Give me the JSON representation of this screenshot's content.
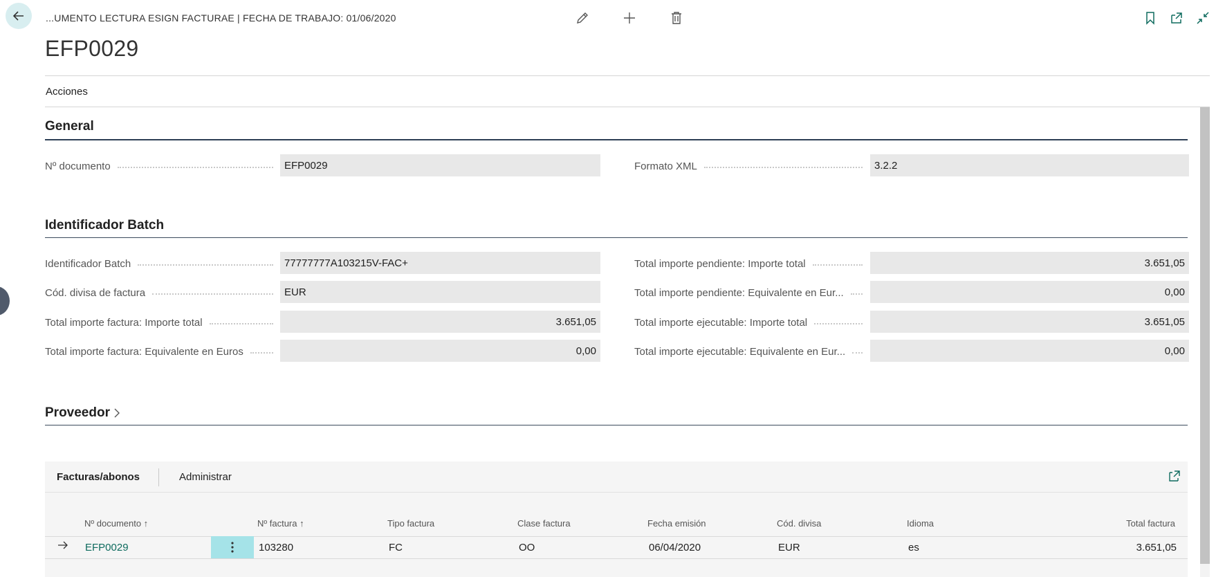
{
  "header": {
    "breadcrumb": "...UMENTO LECTURA ESIGN FACTURAE | FECHA DE TRABAJO: 01/06/2020",
    "title": "EFP0029",
    "actions_menu": "Acciones"
  },
  "icons": {
    "back": "back-arrow-icon",
    "edit": "pencil-icon",
    "new": "plus-icon",
    "delete": "trash-icon",
    "bookmark": "bookmark-icon",
    "open_new": "open-new-window-icon",
    "collapse": "collapse-icon"
  },
  "sections": {
    "general": {
      "title": "General",
      "fields": {
        "doc_no": {
          "label": "Nº documento",
          "value": "EFP0029"
        },
        "xml_format": {
          "label": "Formato XML",
          "value": "3.2.2"
        }
      }
    },
    "batch": {
      "title": "Identificador Batch",
      "fields": {
        "batch_id": {
          "label": "Identificador Batch",
          "value": "77777777A103215V-FAC+"
        },
        "currency": {
          "label": "Cód. divisa de factura",
          "value": "EUR"
        },
        "inv_total": {
          "label": "Total importe factura: Importe total",
          "value": "3.651,05"
        },
        "inv_total_eur": {
          "label": "Total importe factura: Equivalente en Euros",
          "value": "0,00"
        },
        "pend_total": {
          "label": "Total importe pendiente: Importe total",
          "value": "3.651,05"
        },
        "pend_total_eur": {
          "label": "Total importe pendiente: Equivalente en Eur...",
          "value": "0,00"
        },
        "exec_total": {
          "label": "Total importe ejecutable: Importe total",
          "value": "3.651,05"
        },
        "exec_total_eur": {
          "label": "Total importe ejecutable: Equivalente en Eur...",
          "value": "0,00"
        }
      }
    },
    "vendor": {
      "title": "Proveedor"
    }
  },
  "subpage": {
    "tabs": {
      "active": "Facturas/abonos",
      "manage": "Administrar"
    },
    "columns": [
      "Nº documento ↑",
      "Nº factura ↑",
      "Tipo factura",
      "Clase factura",
      "Fecha emisión",
      "Cód. divisa",
      "Idioma",
      "Total factura"
    ],
    "row": {
      "doc_no": "EFP0029",
      "invoice_no": "103280",
      "invoice_type": "FC",
      "invoice_class": "OO",
      "issue_date": "06/04/2020",
      "currency": "EUR",
      "language": "es",
      "total": "3.651,05"
    }
  },
  "colors": {
    "accent": "#0e6b5e",
    "selected_cell": "#a5e3e8"
  }
}
